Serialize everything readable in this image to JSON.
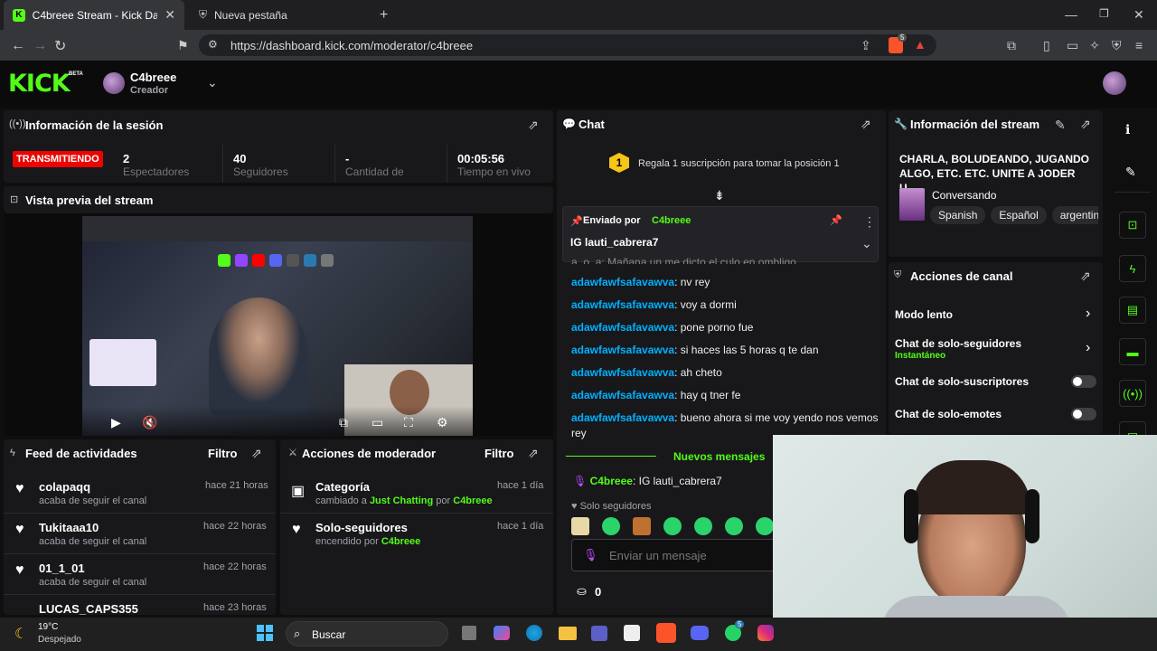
{
  "browser": {
    "tabs": [
      {
        "title": "C4breee Stream - Kick Dashboar"
      },
      {
        "title": "Nueva pestaña"
      }
    ],
    "url": "https://dashboard.kick.com/moderator/c4breee",
    "brave_badge": "5"
  },
  "header": {
    "logo": "KICK",
    "logo_badge": "BETA",
    "channel_name": "C4breee",
    "channel_role": "Creador"
  },
  "session": {
    "title": "Información de la sesión",
    "status": "TRANSMITIENDO",
    "stats": [
      {
        "value": "2",
        "label": "Espectadores"
      },
      {
        "value": "40",
        "label": "Seguidores"
      },
      {
        "value": "-",
        "label": "Cantidad de"
      },
      {
        "value": "00:05:56",
        "label": "Tiempo en vivo"
      }
    ]
  },
  "preview": {
    "title": "Vista previa del stream"
  },
  "feed": {
    "title": "Feed de actividades",
    "filter": "Filtro",
    "items": [
      {
        "name": "colapaqq",
        "desc": "acaba de seguir el canal",
        "time": "hace 21 horas"
      },
      {
        "name": "Tukitaaa10",
        "desc": "acaba de seguir el canal",
        "time": "hace 22 horas"
      },
      {
        "name": "01_1_01",
        "desc": "acaba de seguir el canal",
        "time": "hace 22 horas"
      },
      {
        "name": "LUCAS_CAPS355",
        "desc": "",
        "time": "hace 23 horas"
      }
    ]
  },
  "modactions": {
    "title": "Acciones de moderador",
    "filter": "Filtro",
    "items": [
      {
        "name": "Categoría",
        "prefix": "cambiado a",
        "target": "Just Chatting",
        "by": "por",
        "user": "C4breee",
        "time": "hace 1 día"
      },
      {
        "name": "Solo-seguidores",
        "prefix": "encendido",
        "target": "",
        "by": "por",
        "user": "C4breee",
        "time": "hace 1 día"
      }
    ]
  },
  "chat": {
    "title": "Chat",
    "sub_goal": "Regala 1 suscripción para tomar la posición 1",
    "sub_rank": "1",
    "pinned_label": "Enviado por",
    "pinned_user": "C4breee",
    "pinned_msg": "IG lauti_cabrera7",
    "partial_line": "a_o_a: Mañana un  me dicto el culo en ombligo",
    "messages": [
      {
        "user": "adawfawfsafavawva",
        "text": "nv rey"
      },
      {
        "user": "adawfawfsafavawva",
        "text": "voy a dormi"
      },
      {
        "user": "adawfawfsafavawva",
        "text": "pone porno fue"
      },
      {
        "user": "adawfawfsafavawva",
        "text": "si haces las 5 horas q te dan"
      },
      {
        "user": "adawfawfsafavawva",
        "text": "ah cheto"
      },
      {
        "user": "adawfawfsafavawva",
        "text": "hay q tner fe"
      },
      {
        "user": "adawfawfsafavawva",
        "text": "bueno ahora si me voy yendo nos vemos rey"
      }
    ],
    "new_messages": "Nuevos mensajes",
    "last_user": "C4breee",
    "last_msg": "IG lauti_cabrera7",
    "followers_only": "Solo seguidores",
    "input_placeholder": "Enviar un mensaje",
    "kicks": "0"
  },
  "streaminfo": {
    "title": "Información del stream",
    "stream_title": "CHARLA, BOLUDEANDO, JUGANDO ALGO, ETC. ETC. UNITE A JODER U...",
    "category": "Conversando",
    "tags": [
      "Spanish",
      "Español",
      "argentin"
    ]
  },
  "channelactions": {
    "title": "Acciones de canal",
    "items": [
      {
        "label": "Modo lento",
        "sub": "",
        "kind": "arrow"
      },
      {
        "label": "Chat de solo-seguidores",
        "sub": "Instantáneo",
        "kind": "arrow"
      },
      {
        "label": "Chat de solo-suscriptores",
        "sub": "",
        "kind": "toggle"
      },
      {
        "label": "Chat de solo-emotes",
        "sub": "",
        "kind": "toggle"
      }
    ]
  },
  "taskbar": {
    "temp": "19°C",
    "weather": "Despejado",
    "search": "Buscar",
    "whatsapp_badge": "5"
  },
  "colors": {
    "accent": "#53fc18",
    "user": "#00b0ff",
    "live": "#eb0400"
  }
}
